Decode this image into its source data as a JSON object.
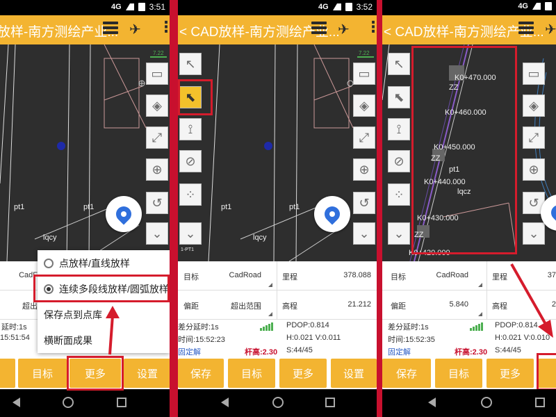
{
  "status": {
    "net": "4G",
    "time1": "3:51",
    "time2": "3:52"
  },
  "panels": [
    {
      "title": "放样-南方测绘产业..."
    },
    {
      "title": "< CAD放样-南方测绘产业..."
    },
    {
      "title": "< CAD放样-南方测绘产业..."
    }
  ],
  "map": {
    "scale": "7.22",
    "pt_label": "pt1",
    "lqcy": "lqcy",
    "p2_tiny": "1-PT1",
    "stations": [
      "K0+470.000",
      "K0+460.000",
      "K0+450.000",
      "K0+440.000",
      "K0+430.000",
      "K0+420.000"
    ],
    "zz": "ZZ",
    "lqcz": "lqcz"
  },
  "fields": {
    "target": "目标",
    "target_val": "CadRoad",
    "target_val_cut": "CadF",
    "mileage": "里程",
    "mileage_val": "378.088",
    "mileage_val_cut": "37",
    "offset": "偏距",
    "offset_val2": "超出范围",
    "offset_val_cut": "超出",
    "offset_val3": "5.840",
    "elev": "高程",
    "elev_val": "21.212",
    "elev_val_cut": "2"
  },
  "status_info": {
    "delay": "差分延时:1s",
    "delay_cut": "延时:1s",
    "time2": "时间:15:52:23",
    "time1_cut": "15:51:54",
    "time3": "时间:15:52:35",
    "fix": "固定解",
    "pole": "杆高:2.30",
    "pdop": "PDOP:0.814",
    "hv2": "H:0.021  V:0.011",
    "hv3": "H:0.021  V:0.010",
    "sats": "S:44/45"
  },
  "buttons": {
    "save": "保存",
    "target": "目标",
    "more": "更多",
    "settings": "设置"
  },
  "menu": {
    "item1": "点放样/直线放样",
    "item2": "连续多段线放样/圆弧放样",
    "item3": "保存点到点库",
    "item4": "横断面成果"
  },
  "icons": [
    "folder-icon",
    "compass-icon",
    "fullscreen-icon",
    "target-icon",
    "magnet-icon",
    "chevron-double-down-icon",
    "cursor-icon",
    "cursor-select-icon",
    "antenna-icon",
    "no-snap-icon",
    "points-icon",
    "location-pin-icon",
    "list-icon",
    "satellite-icon",
    "more-icon"
  ],
  "colors": {
    "accent": "#f3b431",
    "highlight": "#d51c2c",
    "map_bg": "#2e2e2e",
    "pin": "#2f6fdc"
  }
}
